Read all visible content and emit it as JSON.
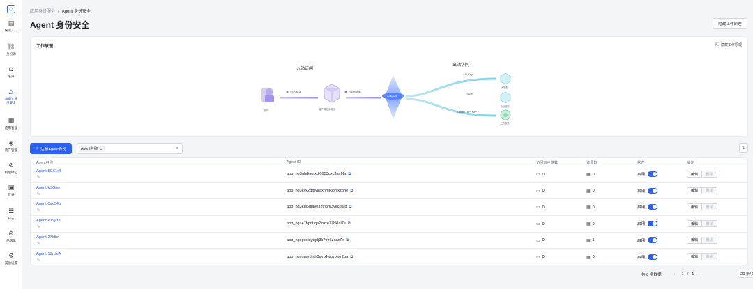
{
  "sidebar": {
    "items": [
      {
        "icon": "monitor-icon",
        "glyph": "▤",
        "label": "快速入门"
      },
      {
        "icon": "identity-source-icon",
        "glyph": "⛓",
        "label": "身份源"
      },
      {
        "icon": "account-icon",
        "glyph": "◘",
        "label": "账户"
      },
      {
        "icon": "agent-security-icon",
        "glyph": "△",
        "label": "Agent 身",
        "label2": "份安全",
        "active": true
      },
      {
        "icon": "apps-icon",
        "glyph": "▦",
        "label": "应用管理"
      },
      {
        "icon": "assets-icon",
        "glyph": "◈",
        "label": "资产管理"
      },
      {
        "icon": "link-icon",
        "glyph": "⊘",
        "label": "权限中心"
      },
      {
        "icon": "login-icon",
        "glyph": "▣",
        "label": "登录"
      },
      {
        "icon": "log-icon",
        "glyph": "☰",
        "label": "日志"
      },
      {
        "icon": "brand-icon",
        "glyph": "⊛",
        "label": "品牌化"
      },
      {
        "icon": "gear-icon",
        "glyph": "⚙",
        "label": "其他设置"
      }
    ]
  },
  "breadcrumb": {
    "parent": "应用身份服务",
    "sep": "/",
    "current": "Agent 身份安全"
  },
  "page_title": "Agent 身份安全",
  "top_hide_button": "隐藏工作原理",
  "diagram": {
    "title": "工作原理",
    "hide_link": "隐藏工作原理",
    "inbound_label": "入站访问",
    "outbound_label": "出站访问",
    "user_label": "用户",
    "app_label": "客户端应用程序",
    "sso_label": "SSO 登录",
    "oauth_label": "OAuth 授权",
    "center_label": "AI Agent",
    "out1_label": "API Key",
    "out2_label": "OAuth",
    "out3_label": "OAuth / API Key",
    "target1": "大模型",
    "target2": "企业服务",
    "target3": "三方服务"
  },
  "toolbar": {
    "register_label": "注册Agent身份",
    "search_field": "Agent名称",
    "search_placeholder": ""
  },
  "table": {
    "headers": [
      "Agent名称",
      "Agent ID",
      "访问客户端数",
      "资源数",
      "状态",
      "操作"
    ],
    "status_text": "启用",
    "edit_label": "编辑",
    "delete_label": "删除",
    "rows": [
      {
        "name": "Agent-5G61o5",
        "id": "app_ng3nhdjaqfxdj6653pxc3ax6fa",
        "clients": "0",
        "resources": "0"
      },
      {
        "name": "Agent-kSGijw",
        "id": "app_ng3kyk2qmylraxnmtkcvxkzphe",
        "clients": "0",
        "resources": "0"
      },
      {
        "name": "Agent-0sxB4u",
        "id": "app_ng3kul6qiave3zthpm3yecgatq",
        "clients": "0",
        "resources": "0"
      },
      {
        "name": "Agent-ku5y33",
        "id": "app_ngz47bpntiqa2zoxe37bklal7e",
        "clients": "0",
        "resources": "0"
      },
      {
        "name": "Agent-27kthn",
        "id": "app_ngxgexisytqdj3k7trz5zczz7e",
        "clients": "0",
        "resources": "1"
      },
      {
        "name": "Agent-19rUeA",
        "id": "app_ngxgagrdfah3ayb4woybwlr2qa",
        "clients": "0",
        "resources": "0"
      }
    ]
  },
  "pagination": {
    "total": "共 6 条数据",
    "current": "1",
    "sep": "/",
    "pages": "1",
    "page_size": "20 条/页"
  },
  "colors": {
    "accent": "#2b62f4",
    "cyan": "#4fc3e0",
    "purple": "#8b78e6"
  }
}
